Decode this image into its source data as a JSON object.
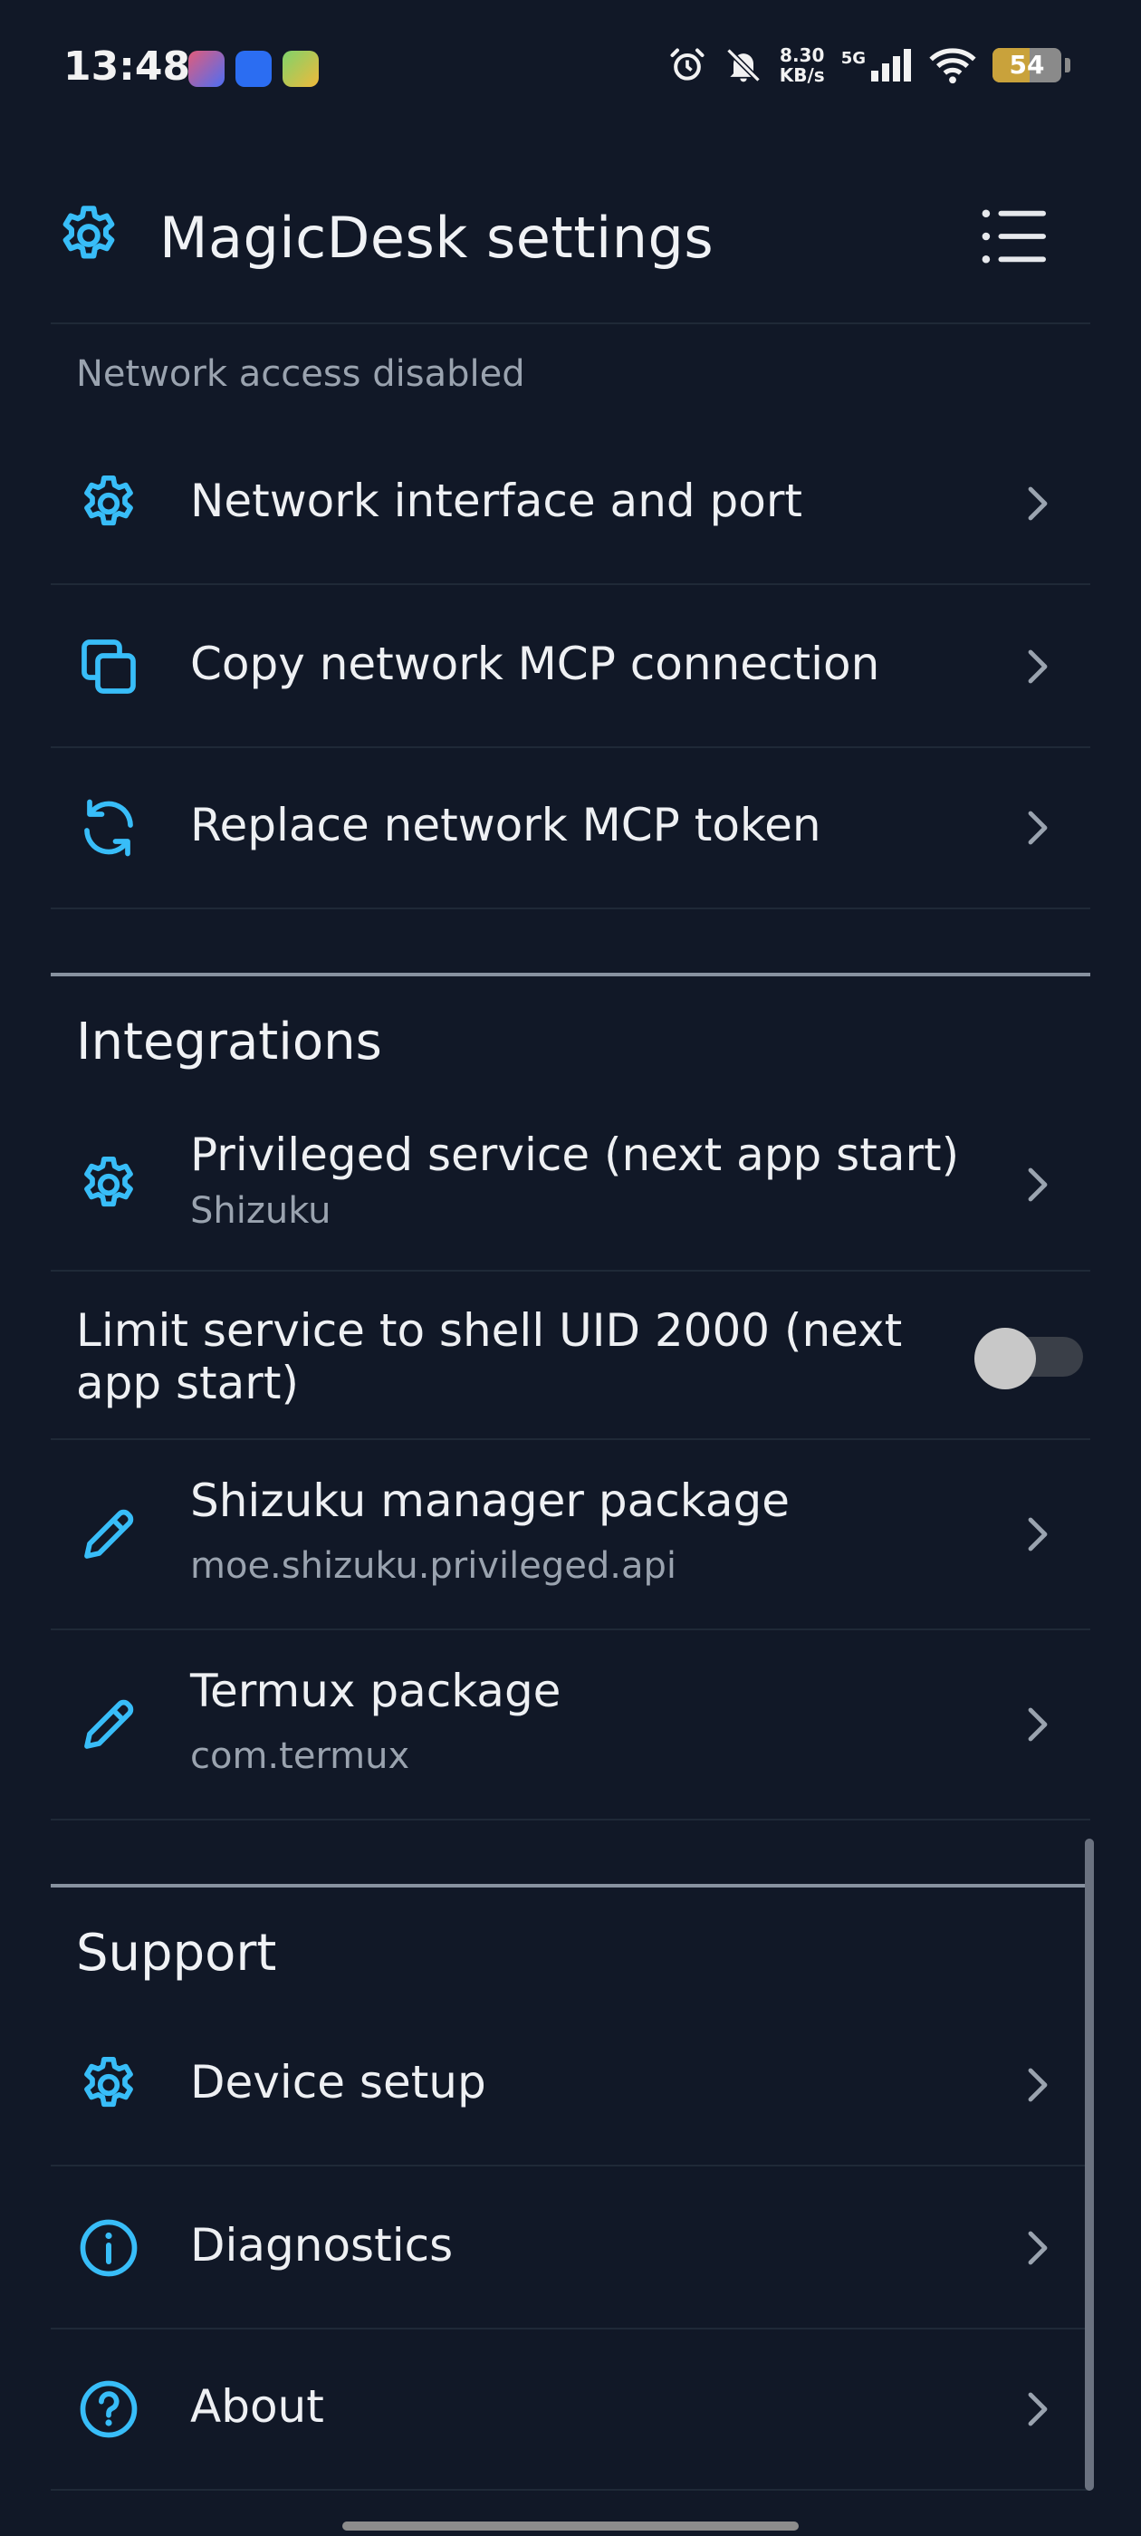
{
  "status_bar": {
    "time": "13:48",
    "speed_value": "8.30",
    "speed_unit": "KB/s",
    "network": "5G",
    "battery": "54",
    "battery_level_percent": 54,
    "icons": [
      "alarm-icon",
      "bell-off-icon",
      "signal-icon",
      "wifi-icon",
      "battery-icon"
    ]
  },
  "app_bar": {
    "title": "MagicDesk settings",
    "icon": "gear-icon",
    "menu_icon": "menu-list-icon"
  },
  "network": {
    "caption": "Network access disabled",
    "items": [
      {
        "label": "Network interface and port",
        "icon": "gear-icon"
      },
      {
        "label": "Copy network MCP connection",
        "icon": "copy-icon"
      },
      {
        "label": "Replace network MCP token",
        "icon": "refresh-icon"
      }
    ]
  },
  "integrations": {
    "title": "Integrations",
    "privileged": {
      "label": "Privileged service (next app start)",
      "value": "Shizuku",
      "icon": "gear-icon"
    },
    "limit_toggle": {
      "label_line1": "Limit service to shell UID 2000 (next",
      "label_line2": "app start)",
      "checked": false
    },
    "shizuku_pkg": {
      "label": "Shizuku manager package",
      "value": "moe.shizuku.privileged.api",
      "icon": "pencil-icon"
    },
    "termux_pkg": {
      "label": "Termux package",
      "value": "com.termux",
      "icon": "pencil-icon"
    }
  },
  "support": {
    "title": "Support",
    "items": [
      {
        "label": "Device setup",
        "icon": "gear-icon"
      },
      {
        "label": "Diagnostics",
        "icon": "info-icon"
      },
      {
        "label": "About",
        "icon": "help-icon"
      }
    ]
  },
  "colors": {
    "background": "#111827",
    "accent": "#38bdf8",
    "text_primary": "#eef0f3",
    "text_secondary": "#9aa3af"
  }
}
